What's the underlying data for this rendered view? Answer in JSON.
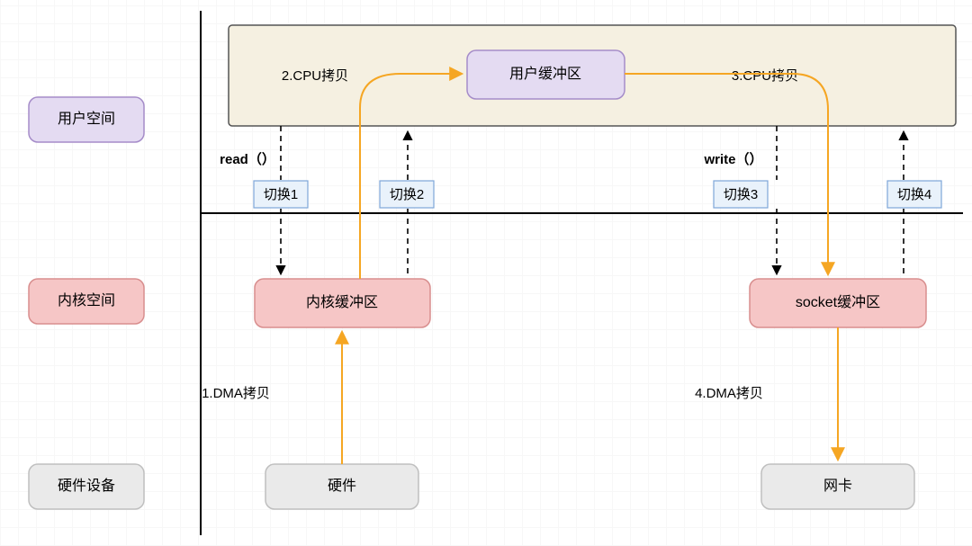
{
  "rows": {
    "user_space": "用户空间",
    "kernel_space": "内核空间",
    "hardware": "硬件设备"
  },
  "nodes": {
    "user_buffer": "用户缓冲区",
    "kernel_buffer": "内核缓冲区",
    "socket_buffer": "socket缓冲区",
    "hardware": "硬件",
    "nic": "网卡"
  },
  "switches": {
    "s1": "切换1",
    "s2": "切换2",
    "s3": "切换3",
    "s4": "切换4"
  },
  "syscalls": {
    "read": "read（）",
    "write": "write（）"
  },
  "copies": {
    "c1": "1.DMA拷贝",
    "c2": "2.CPU拷贝",
    "c3": "3.CPU拷贝",
    "c4": "4.DMA拷贝"
  },
  "colors": {
    "purple_fill": "#e4dbf2",
    "purple_stroke": "#a58cc9",
    "pink_fill": "#f6c6c6",
    "pink_stroke": "#d88e8e",
    "gray_fill": "#eaeaea",
    "gray_stroke": "#bfbfbf",
    "cream_fill": "#f5f0e1",
    "cream_stroke": "#555555",
    "blue_fill": "#e9f2fb",
    "blue_stroke": "#7ea7d8",
    "orange": "#f5a623",
    "black": "#000000"
  }
}
